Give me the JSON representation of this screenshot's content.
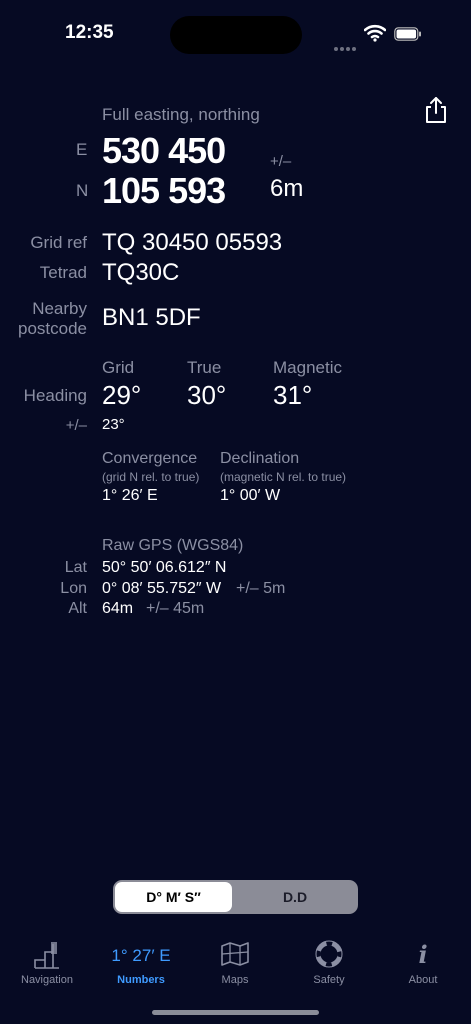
{
  "status": {
    "time": "12:35"
  },
  "header": {
    "section_label": "Full easting, northing"
  },
  "coords": {
    "e_label": "E",
    "n_label": "N",
    "easting": "530 450",
    "northing": "105 593",
    "accuracy_label": "+/–",
    "accuracy_value": "6m"
  },
  "grid_ref": {
    "label": "Grid ref",
    "value": "TQ 30450 05593"
  },
  "tetrad": {
    "label": "Tetrad",
    "value": "TQ30C"
  },
  "postcode": {
    "label_line1": "Nearby",
    "label_line2": "postcode",
    "value": "BN1 5DF"
  },
  "heading": {
    "label": "Heading",
    "col_grid": "Grid",
    "col_true": "True",
    "col_magnetic": "Magnetic",
    "grid_value": "29°",
    "true_value": "30°",
    "magnetic_value": "31°",
    "accuracy_label": "+/–",
    "accuracy_value": "23°"
  },
  "convergence": {
    "title": "Convergence",
    "subtitle": "(grid N rel. to true)",
    "value": "1° 26′ E"
  },
  "declination": {
    "title": "Declination",
    "subtitle": "(magnetic N rel. to true)",
    "value": "1° 00′ W"
  },
  "raw_gps": {
    "title": "Raw GPS (WGS84)",
    "lat_label": "Lat",
    "lat_value": "50° 50′ 06.612″ N",
    "lon_label": "Lon",
    "lon_value": "0° 08′ 55.752″ W",
    "lon_accuracy": "+/– 5m",
    "alt_label": "Alt",
    "alt_value": "64m",
    "alt_accuracy": "+/– 45m"
  },
  "format_toggle": {
    "selected": "D° M′ S″",
    "other": "D.D"
  },
  "tabs": [
    {
      "label": "Navigation",
      "icon": "navigation-map-icon"
    },
    {
      "label": "Numbers",
      "icon": "heading-readout",
      "readout": "1° 27′ E"
    },
    {
      "label": "Maps",
      "icon": "map-icon"
    },
    {
      "label": "Safety",
      "icon": "lifebuoy-icon"
    },
    {
      "label": "About",
      "icon": "info-icon"
    }
  ],
  "colors": {
    "background": "#060a23",
    "accent": "#3f9bff",
    "muted": "#8b8fa3"
  }
}
